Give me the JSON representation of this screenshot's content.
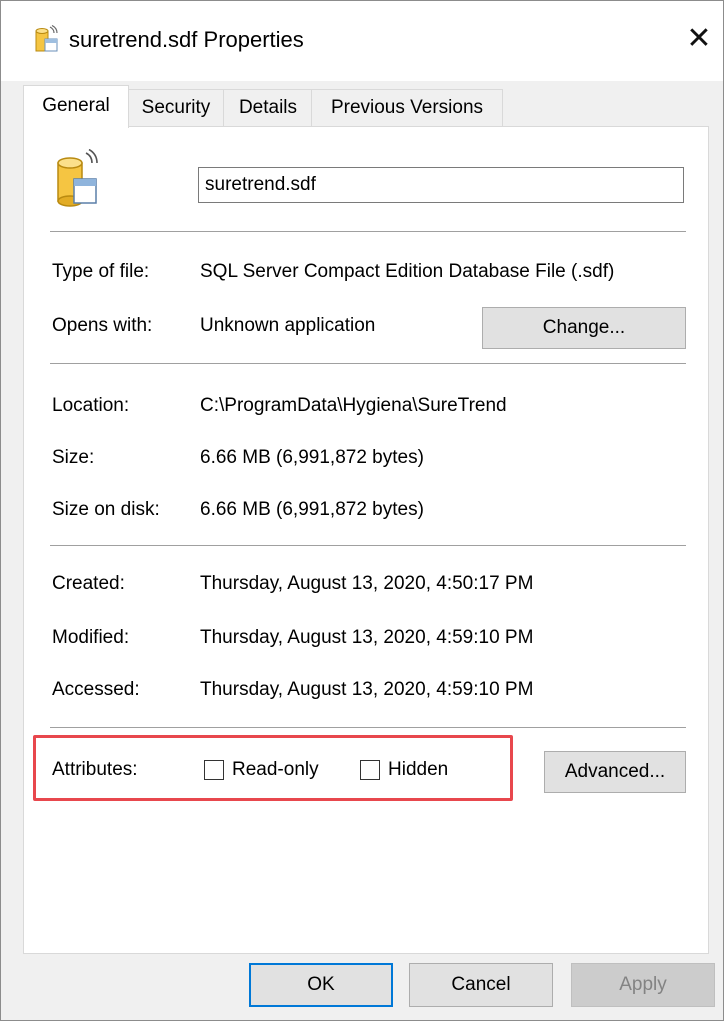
{
  "window": {
    "title": "suretrend.sdf Properties",
    "close_label": "✕"
  },
  "tabs": [
    {
      "label": "General",
      "active": true
    },
    {
      "label": "Security",
      "active": false
    },
    {
      "label": "Details",
      "active": false
    },
    {
      "label": "Previous Versions",
      "active": false
    }
  ],
  "general": {
    "file_name": "suretrend.sdf",
    "type_label": "Type of file:",
    "type_value": "SQL Server Compact Edition Database File (.sdf)",
    "opens_label": "Opens with:",
    "opens_value": "Unknown application",
    "change_button": "Change...",
    "location_label": "Location:",
    "location_value": "C:\\ProgramData\\Hygiena\\SureTrend",
    "size_label": "Size:",
    "size_value": "6.66 MB (6,991,872 bytes)",
    "size_on_disk_label": "Size on disk:",
    "size_on_disk_value": "6.66 MB (6,991,872 bytes)",
    "created_label": "Created:",
    "created_value": "Thursday, August 13, 2020, 4:50:17 PM",
    "modified_label": "Modified:",
    "modified_value": "Thursday, August 13, 2020, 4:59:10 PM",
    "accessed_label": "Accessed:",
    "accessed_value": "Thursday, August 13, 2020, 4:59:10 PM",
    "attributes_label": "Attributes:",
    "readonly_label": "Read-only",
    "readonly_checked": false,
    "hidden_label": "Hidden",
    "hidden_checked": false,
    "advanced_button": "Advanced..."
  },
  "footer": {
    "ok": "OK",
    "cancel": "Cancel",
    "apply": "Apply"
  },
  "colors": {
    "highlight_box": "#e8474d",
    "default_button_border": "#0078d7"
  }
}
